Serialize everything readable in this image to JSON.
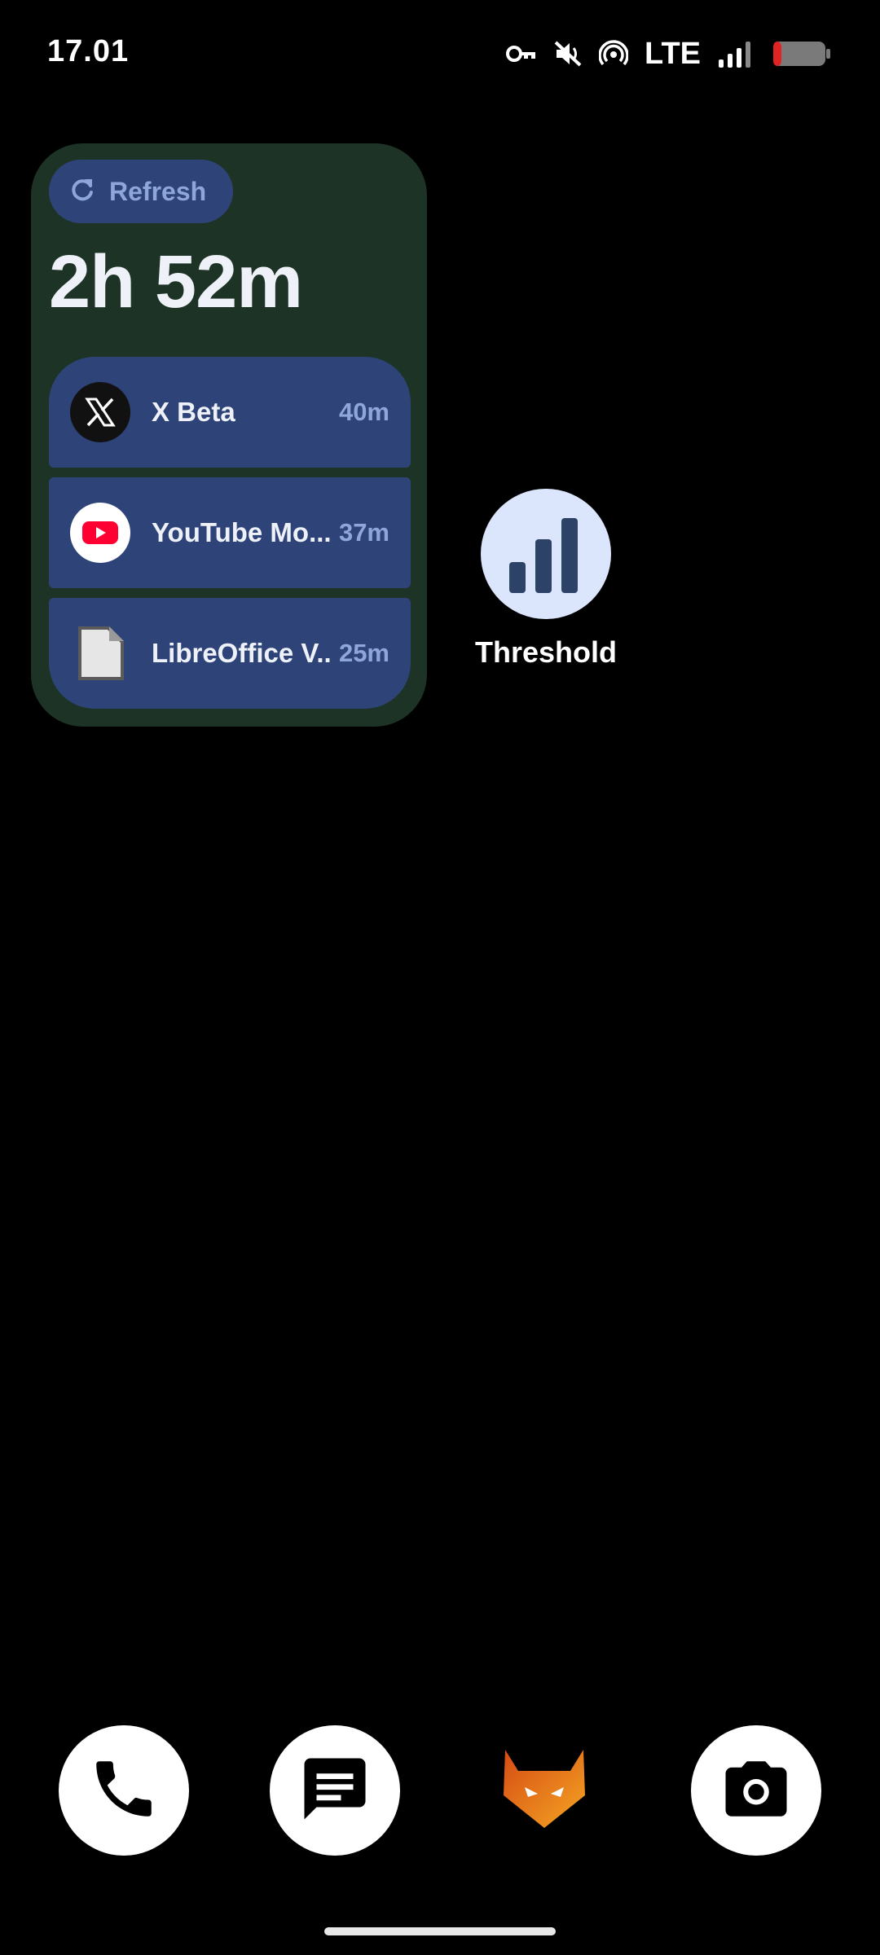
{
  "status_bar": {
    "time": "17.01",
    "network": "LTE",
    "icons": [
      "vpn-key-icon",
      "mute-icon",
      "hotspot-icon",
      "signal-icon",
      "battery-low-icon"
    ]
  },
  "widget": {
    "refresh_label": "Refresh",
    "total_time": "2h 52m",
    "apps": [
      {
        "name": "X Beta",
        "time": "40m",
        "icon": "x-logo-icon"
      },
      {
        "name": "YouTube Mo...",
        "time": "37m",
        "icon": "youtube-icon"
      },
      {
        "name": "LibreOffice V...",
        "time": "25m",
        "icon": "libreoffice-icon"
      }
    ]
  },
  "home_app": {
    "label": "Threshold",
    "icon": "bar-chart-icon",
    "icon_bg": "#dbe6fd",
    "icon_fg": "#2c4266"
  },
  "dock": {
    "items": [
      "phone-icon",
      "messages-icon",
      "gitlab-icon",
      "camera-icon"
    ]
  },
  "colors": {
    "widget_bg": "#1d3326",
    "row_bg": "#2e4478",
    "accent_text": "#8ea6d9",
    "battery_low": "#e02424"
  }
}
